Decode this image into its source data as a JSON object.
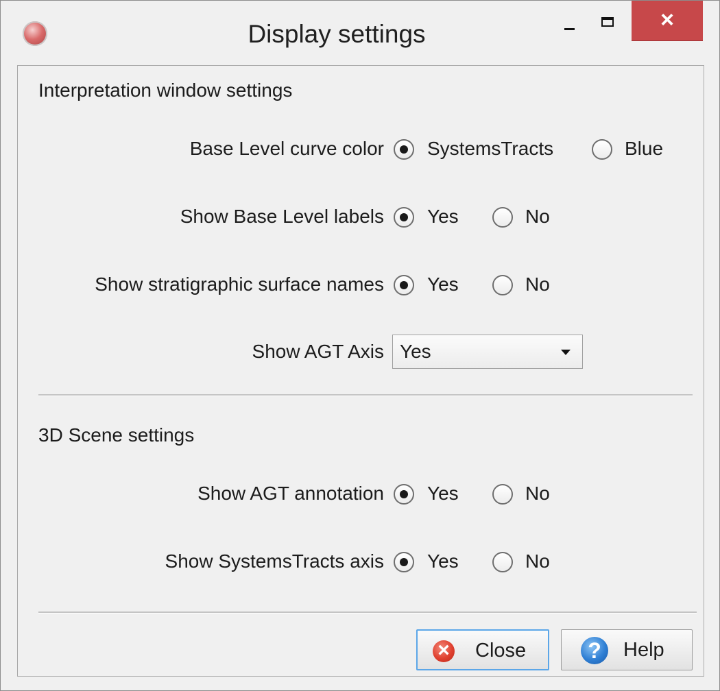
{
  "window": {
    "title": "Display settings",
    "controls": {
      "minimize": "—",
      "maximize": "□",
      "close": "×"
    }
  },
  "interpretation": {
    "section_title": "Interpretation window settings",
    "base_level_color": {
      "label": "Base Level curve color",
      "options": [
        {
          "label": "SystemsTracts",
          "selected": true
        },
        {
          "label": "Blue",
          "selected": false
        }
      ]
    },
    "base_level_labels": {
      "label": "Show Base Level labels",
      "options": [
        {
          "label": "Yes",
          "selected": true
        },
        {
          "label": "No",
          "selected": false
        }
      ]
    },
    "surface_names": {
      "label": "Show stratigraphic surface names",
      "options": [
        {
          "label": "Yes",
          "selected": true
        },
        {
          "label": "No",
          "selected": false
        }
      ]
    },
    "agt_axis": {
      "label": "Show AGT Axis",
      "value": "Yes"
    }
  },
  "scene3d": {
    "section_title": "3D Scene settings",
    "agt_annotation": {
      "label": "Show AGT annotation",
      "options": [
        {
          "label": "Yes",
          "selected": true
        },
        {
          "label": "No",
          "selected": false
        }
      ]
    },
    "systemstracts_axis": {
      "label": "Show SystemsTracts axis",
      "options": [
        {
          "label": "Yes",
          "selected": true
        },
        {
          "label": "No",
          "selected": false
        }
      ]
    }
  },
  "footer": {
    "close_label": "Close",
    "help_label": "Help"
  },
  "colors": {
    "close_accent": "#c7484a",
    "focus_border": "#5ba6e8",
    "help_icon": "#2f7fd4",
    "close_icon": "#e0402f"
  }
}
